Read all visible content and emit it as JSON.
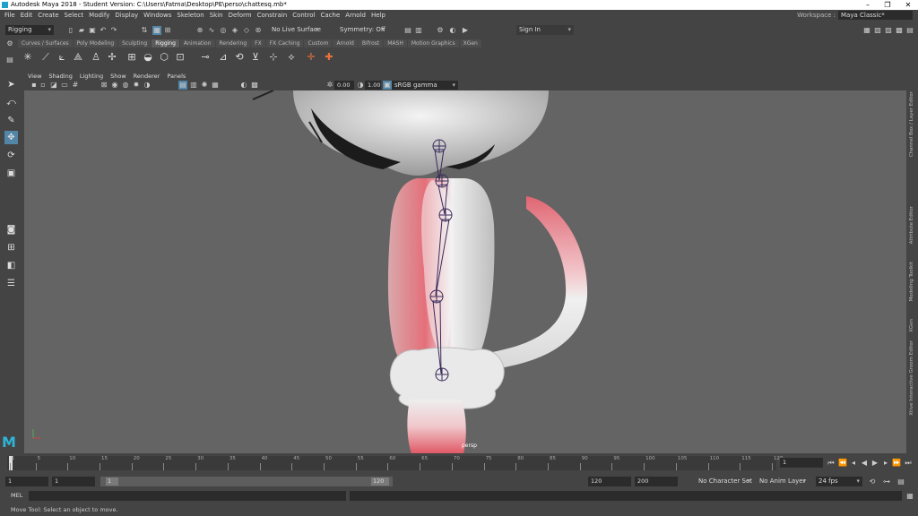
{
  "window": {
    "title": "Autodesk Maya 2018 - Student Version: C:\\Users\\Fatma\\Desktop\\PE\\perso\\chattesq.mb*",
    "min": "–",
    "max": "❐",
    "close": "✕"
  },
  "menubar": [
    "File",
    "Edit",
    "Create",
    "Select",
    "Modify",
    "Display",
    "Windows",
    "Skeleton",
    "Skin",
    "Deform",
    "Constrain",
    "Control",
    "Cache",
    "Arnold",
    "Help"
  ],
  "workspace": {
    "label": "Workspace :",
    "value": "Maya Classic*"
  },
  "statusline": {
    "menuset": "Rigging",
    "live_surface": "No Live Surface",
    "symmetry": "Symmetry: Off",
    "sign_in": "Sign In"
  },
  "shelf_tabs": [
    "Curves / Surfaces",
    "Poly Modeling",
    "Sculpting",
    "Rigging",
    "Animation",
    "Rendering",
    "FX",
    "FX Caching",
    "Custom",
    "Arnold",
    "Bifrost",
    "MASH",
    "Motion Graphics",
    "XGen"
  ],
  "active_shelf_tab": "Rigging",
  "viewport": {
    "menus": [
      "View",
      "Shading",
      "Lighting",
      "Show",
      "Renderer",
      "Panels"
    ],
    "near_value": "0.00",
    "far_value": "1.00",
    "color_space": "sRGB gamma",
    "camera_label": "persp"
  },
  "right_tabs": [
    "Channel Box / Layer Editor",
    "Attribute Editor",
    "Modeling Toolkit",
    "XGen",
    "Xtive Interactive Groom Editor"
  ],
  "timeslider": {
    "ticks": [
      "1",
      "5",
      "10",
      "15",
      "20",
      "25",
      "30",
      "35",
      "40",
      "45",
      "50",
      "55",
      "60",
      "65",
      "70",
      "75",
      "80",
      "85",
      "90",
      "95",
      "100",
      "105",
      "110",
      "115",
      "120"
    ],
    "current_frame": "1"
  },
  "range": {
    "start": "1",
    "start_inner": "1",
    "range_start": "1",
    "range_end": "120",
    "end_inner": "120",
    "end": "200",
    "character_set": "No Character Set",
    "anim_layer": "No Anim Layer",
    "fps": "24 fps"
  },
  "cmdline": {
    "label": "MEL"
  },
  "helpline": "Move Tool: Select an object to move.",
  "colors": {
    "accent": "#5285a6",
    "viewport_bg": "#646464",
    "joint": "#3a2a5a",
    "skin_weight": "#e0707a"
  }
}
